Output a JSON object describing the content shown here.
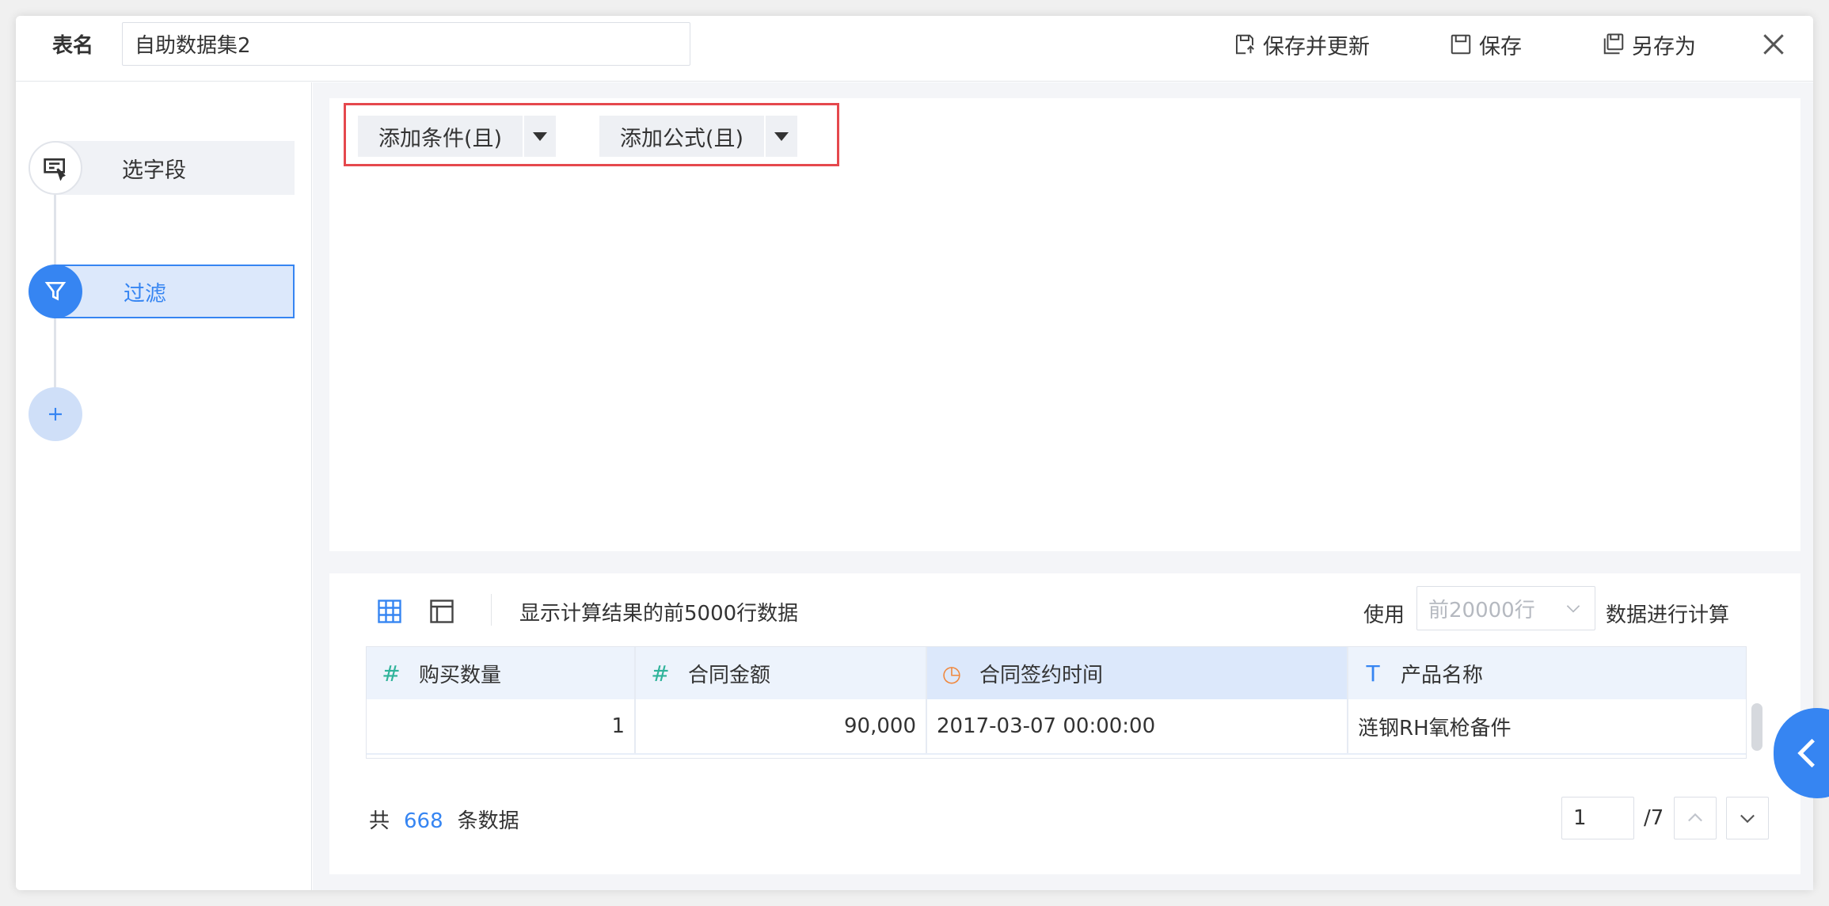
{
  "header": {
    "table_name_label": "表名",
    "table_name_value": "自助数据集2",
    "save_update_label": "保存并更新",
    "save_label": "保存",
    "save_as_label": "另存为"
  },
  "steps": [
    {
      "label": "选字段",
      "icon": "select-field-icon"
    },
    {
      "label": "过滤",
      "icon": "filter-icon",
      "active": true
    },
    {
      "icon": "plus-icon"
    }
  ],
  "filter": {
    "add_condition_label": "添加条件(且)",
    "add_formula_label": "添加公式(且)"
  },
  "preview": {
    "info": "显示计算结果的前5000行数据",
    "use_label": "使用",
    "rows_option": "前20000行",
    "calc_label": "数据进行计算",
    "columns": [
      {
        "name": "购买数量",
        "type_icon": "#",
        "type": "number"
      },
      {
        "name": "合同金额",
        "type_icon": "#",
        "type": "number"
      },
      {
        "name": "合同签约时间",
        "type_icon": "◷",
        "type": "date"
      },
      {
        "name": "产品名称",
        "type_icon": "T",
        "type": "text"
      }
    ],
    "rows": [
      [
        "1",
        "90,000",
        "2017-03-07 00:00:00",
        "涟钢RH氧枪备件"
      ]
    ],
    "footer_prefix": "共",
    "total_count": "668",
    "footer_suffix": "条数据",
    "current_page": "1",
    "total_pages": "/7"
  },
  "colors": {
    "accent": "#3685f2",
    "highlight": "#e5484d",
    "number_icon": "#2fb39a",
    "date_icon": "#f0883e",
    "text_icon": "#3685f2"
  }
}
